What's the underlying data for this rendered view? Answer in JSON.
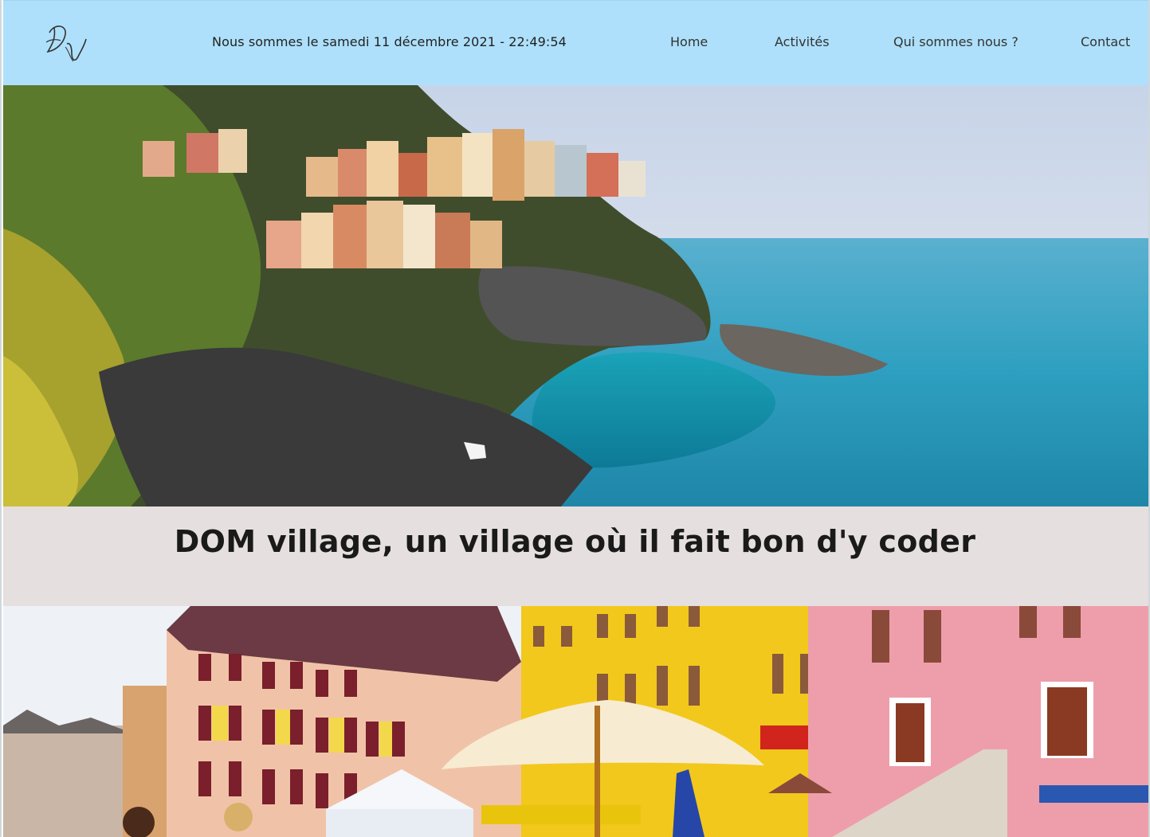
{
  "header": {
    "logo_text": "DV",
    "datetime": "Nous sommes le samedi 11 décembre 2021 - 22:49:54"
  },
  "nav": {
    "home": "Home",
    "activites": "Activités",
    "qui": "Qui sommes nous ?",
    "contact": "Contact"
  },
  "main": {
    "headline": "DOM village, un village où il fait bon d'y coder"
  },
  "colors": {
    "header_bg": "#aee0fb",
    "band_bg": "#e6dfdf",
    "sea": "#2e9fc0"
  },
  "icons": {
    "logo": "script-monogram-logo"
  }
}
